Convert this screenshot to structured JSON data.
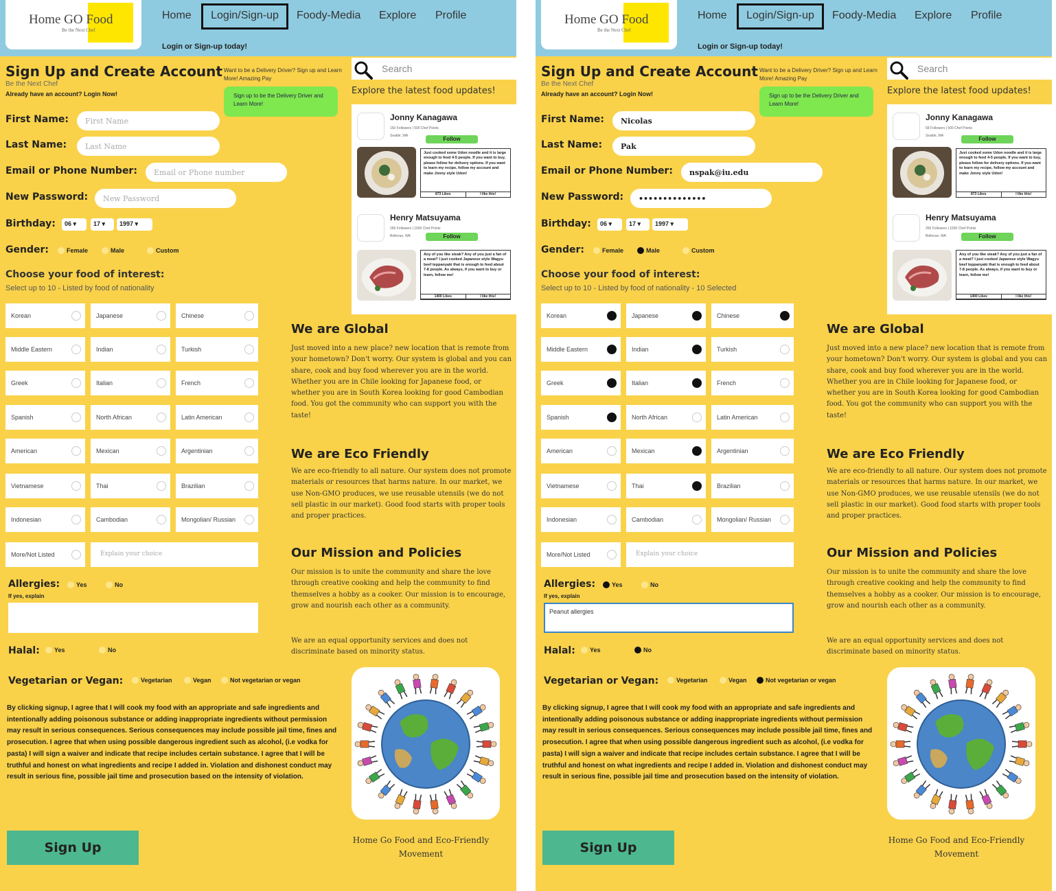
{
  "nav": {
    "logo_title": "Home GO Food",
    "logo_subtitle": "Be the Next Chef",
    "home": "Home",
    "login": "Login/Sign-up",
    "foody_media": "Foody-Media",
    "explore": "Explore",
    "profile": "Profile",
    "tagline": "Login or Sign-up today!"
  },
  "form": {
    "title": "Sign Up and Create Account",
    "subtitle": "Be the Next Chef",
    "have_account": "Already have an account? Login Now!",
    "driver_text": "Want to be a Delivery Driver? Sign up and Learn More! Amazing Pay",
    "driver_button": "Sign up to be the Delivery Driver and Learn More!",
    "first_name_label": "First Name:",
    "last_name_label": "Last Name:",
    "email_label": "Email or Phone Number:",
    "password_label": "New Password:",
    "birthday_label": "Birthday:",
    "gender_label": "Gender:",
    "gender_options": [
      "Female",
      "Male",
      "Custom"
    ],
    "choose_title": "Choose your food of interest:",
    "allergies_label": "Allergies:",
    "allergy_if_yes": "If yes, explain",
    "yes": "Yes",
    "no": "No",
    "halal_label": "Halal:",
    "veg_label": "Vegetarian or Vegan:",
    "veg_options": [
      "Vegetarian",
      "Vegan",
      "Not vegetarian or vegan"
    ],
    "explain_placeholder": "Explain your choice",
    "terms": "By clicking signup, I agree that I will cook my food with an appropriate and safe ingredients and intentionally adding poisonous substance or adding inappropriate ingredients without permission may result in serious consequences. Serious consequences may include possible jail time, fines and prosecution.  I agree that when using possible dangerous ingredient such as alcohol, (i.e vodka for pasta) I will sign a waiver and indicate that recipe includes certain substance. I agree that I will be truthful and honest on what ingredients and recipe I added in. Violation and dishonest conduct may result in serious fine, possible jail time and prosecution based on the intensity of violation.",
    "signup_button": "Sign Up"
  },
  "foods": [
    "Korean",
    "Japanese",
    "Chinese",
    "Middle Eastern",
    "Indian",
    "Turkish",
    "Greek",
    "Italian",
    "French",
    "Spanish",
    "North African",
    "Latin American",
    "American",
    "Mexican",
    "Argentinian",
    "Vietnamese",
    "Thai",
    "Brazilian",
    "Indonesian",
    "Cambodian",
    "Mongolian/ Russian",
    "More/Not Listed"
  ],
  "side": {
    "search_placeholder": "Search",
    "explore_latest": "Explore the latest food updates!",
    "posts": [
      {
        "name": "Jonny Kanagawa",
        "follow": "Follow",
        "caption": "Just cooked some Udon noodle and it is large enough to feed 4-5 people. If you want to buy, please follow for delivery options. If you want to learn my recipe, follow my account and make Jonny style Udon!"
      },
      {
        "name": "Henry Matsuyama",
        "location": "Bellevue, WA",
        "follow": "Follow",
        "caption": "Any of you like steak? Any of you just a fan of a meat? I just cooked Japanese style Wagyu beef teppanyaki that is enough to feed about 7-8 people. As always, if you want to buy or learn, follow me!"
      }
    ],
    "like_btn": "I like this!",
    "global_title": "We are Global",
    "global_text": "Just moved into a new place? new location that is remote from your hometown? Don't worry. Our system is global and you can share, cook and buy food wherever you are in the world. Whether you are in Chile looking for Japanese food, or whether you are in South Korea looking for good Cambodian food. You got the community who can support you with the taste!",
    "eco_title": "We are Eco Friendly",
    "eco_text": "We are eco-friendly to all nature. Our system does not promote materials or resources that harms nature. In our market, we use Non-GMO produces, we use reusable utensils (we do not sell plastic in our market). Good food starts with proper tools and proper practices.",
    "mission_title": "Our Mission and Policies",
    "mission_text": "Our mission is to unite the community and share the love through creative cooking and help the community to find themselves a hobby as a cooker. Our mission is to encourage, grow and nourish each other as a community.",
    "equal_text": "We are an equal opportunity services and does not discriminate based on minority status.",
    "footer": "Home Go Food and Eco-Friendly Movement"
  },
  "panels": [
    {
      "first_name": "",
      "first_placeholder": "First Name",
      "last_name": "",
      "last_placeholder": "Last Name",
      "email": "",
      "email_placeholder": "Email or Phone number",
      "password": "",
      "password_placeholder": "New Password",
      "bday_month": "06 ▾",
      "bday_day": "17 ▾",
      "bday_year": "1997 ▾",
      "gender": "",
      "choose_sub": "Select up to 10  -  Listed by food of nationality",
      "selected_foods": [],
      "allergies": "",
      "allergy_text": "",
      "halal": "",
      "veg": "",
      "post1_meta1": "150 Followers  |  500 Chef Points",
      "post1_meta2": "Seattle, WA",
      "post1_likes": "873 Likes",
      "post2_meta1": "265 Followers  |  1500 Chef Points",
      "post2_likes": "1400 Likes"
    },
    {
      "first_name": "Nicolas",
      "first_placeholder": "",
      "last_name": "Pak",
      "last_placeholder": "",
      "email": "nspak@iu.edu",
      "email_placeholder": "",
      "password": "••••••••••••••",
      "password_placeholder": "",
      "bday_month": "06 ▾",
      "bday_day": "17 ▾",
      "bday_year": "1997 ▾",
      "gender": "Male",
      "choose_sub": "Select up to 10  -  Listed by food of nationality  -  10 Selected",
      "selected_foods": [
        "Korean",
        "Japanese",
        "Chinese",
        "Middle Eastern",
        "Indian",
        "Greek",
        "Italian",
        "Spanish",
        "Mexican",
        "Thai"
      ],
      "allergies": "Yes",
      "allergy_text": "Peanut allergies",
      "halal": "No",
      "veg": "Not vegetarian or vegan",
      "post1_meta1": "68 Followers  |  500 Chef Points",
      "post1_meta2": "Seattle, WA",
      "post1_likes": "873 Likes",
      "post2_meta1": "265 Followers  |  1500 Chef Points",
      "post2_likes": "1400 Likes"
    }
  ],
  "colors": {
    "background": "#f9d24a",
    "topbar": "#8fcbe0",
    "accent_green": "#7fe84f",
    "signup_button": "#4db78f"
  }
}
